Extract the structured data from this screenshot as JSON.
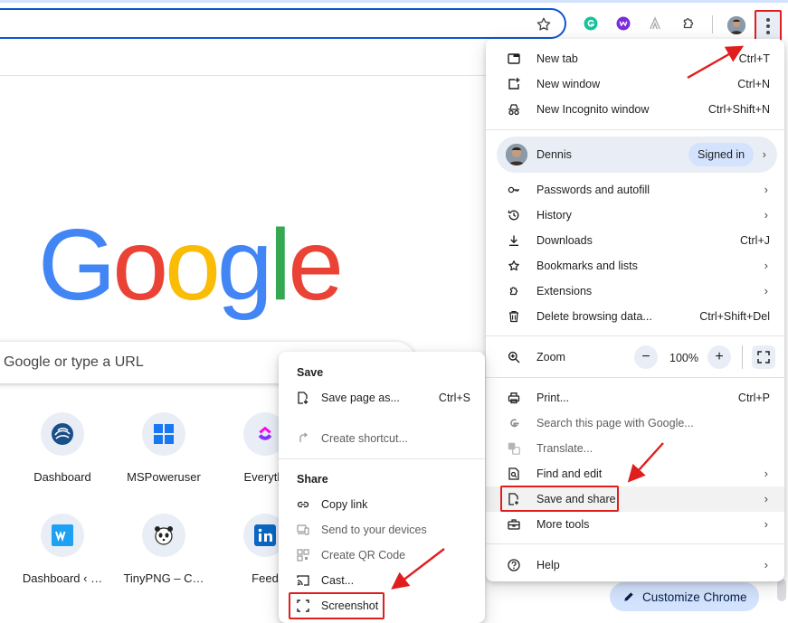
{
  "colors": {
    "accent": "#0b57d0",
    "highlight_red": "#e01e1e",
    "menu_bg": "#ffffff",
    "chip_bg": "#d3e3fd"
  },
  "toolbar": {
    "icons": [
      "star-icon",
      "grammarly-icon",
      "extension-purple-icon",
      "extension-a-icon",
      "puzzle-icon",
      "avatar",
      "kebab-menu-icon"
    ]
  },
  "page": {
    "logo_letters": [
      "G",
      "o",
      "o",
      "g",
      "l",
      "e"
    ],
    "search_placeholder": "Google or type a URL",
    "shortcuts": [
      {
        "label": "Dashboard",
        "icon": "spiral-icon"
      },
      {
        "label": "MSPoweruser",
        "icon": "windows-icon"
      },
      {
        "label": "Everythi",
        "icon": "clickup-icon"
      },
      {
        "label": "Dashboard ‹ …",
        "icon": "w-icon"
      },
      {
        "label": "TinyPNG – C…",
        "icon": "panda-icon"
      },
      {
        "label": "Feed",
        "icon": "linkedin-icon"
      }
    ],
    "customize_label": "Customize Chrome"
  },
  "menu": {
    "items_top": [
      {
        "label": "New tab",
        "shortcut": "Ctrl+T",
        "icon": "new-tab-icon"
      },
      {
        "label": "New window",
        "shortcut": "Ctrl+N",
        "icon": "new-window-icon"
      },
      {
        "label": "New Incognito window",
        "shortcut": "Ctrl+Shift+N",
        "icon": "incognito-icon"
      }
    ],
    "profile": {
      "name": "Dennis",
      "status": "Signed in"
    },
    "items_mid": [
      {
        "label": "Passwords and autofill",
        "shortcut": "",
        "icon": "key-icon",
        "submenu": true
      },
      {
        "label": "History",
        "shortcut": "",
        "icon": "history-icon",
        "submenu": true
      },
      {
        "label": "Downloads",
        "shortcut": "Ctrl+J",
        "icon": "download-icon",
        "submenu": false
      },
      {
        "label": "Bookmarks and lists",
        "shortcut": "",
        "icon": "star-outline-icon",
        "submenu": true
      },
      {
        "label": "Extensions",
        "shortcut": "",
        "icon": "puzzle-icon",
        "submenu": true
      },
      {
        "label": "Delete browsing data...",
        "shortcut": "Ctrl+Shift+Del",
        "icon": "trash-icon",
        "submenu": false
      }
    ],
    "zoom": {
      "label": "Zoom",
      "minus": "−",
      "value": "100%",
      "plus": "+"
    },
    "items_bottom": [
      {
        "label": "Print...",
        "shortcut": "Ctrl+P",
        "icon": "print-icon",
        "submenu": false,
        "dim": false
      },
      {
        "label": "Search this page with Google...",
        "shortcut": "",
        "icon": "google-g-icon",
        "submenu": false,
        "dim": true
      },
      {
        "label": "Translate...",
        "shortcut": "",
        "icon": "translate-icon",
        "submenu": false,
        "dim": true
      },
      {
        "label": "Find and edit",
        "shortcut": "",
        "icon": "find-icon",
        "submenu": true,
        "dim": false
      },
      {
        "label": "Save and share",
        "shortcut": "",
        "icon": "save-share-icon",
        "submenu": true,
        "dim": false
      },
      {
        "label": "More tools",
        "shortcut": "",
        "icon": "toolbox-icon",
        "submenu": true,
        "dim": false
      }
    ],
    "help": {
      "label": "Help",
      "icon": "help-icon"
    }
  },
  "submenu": {
    "save_header": "Save",
    "save_items": [
      {
        "label": "Save page as...",
        "shortcut": "Ctrl+S",
        "icon": "save-page-icon",
        "dim": false
      },
      {
        "label": "Create shortcut...",
        "shortcut": "",
        "icon": "shortcut-icon",
        "dim": true
      }
    ],
    "share_header": "Share",
    "share_items": [
      {
        "label": "Copy link",
        "icon": "link-icon",
        "dim": false
      },
      {
        "label": "Send to your devices",
        "icon": "devices-icon",
        "dim": true
      },
      {
        "label": "Create QR Code",
        "icon": "qr-icon",
        "dim": true
      },
      {
        "label": "Cast...",
        "icon": "cast-icon",
        "dim": false
      },
      {
        "label": "Screenshot",
        "icon": "screenshot-icon",
        "dim": false
      }
    ]
  }
}
